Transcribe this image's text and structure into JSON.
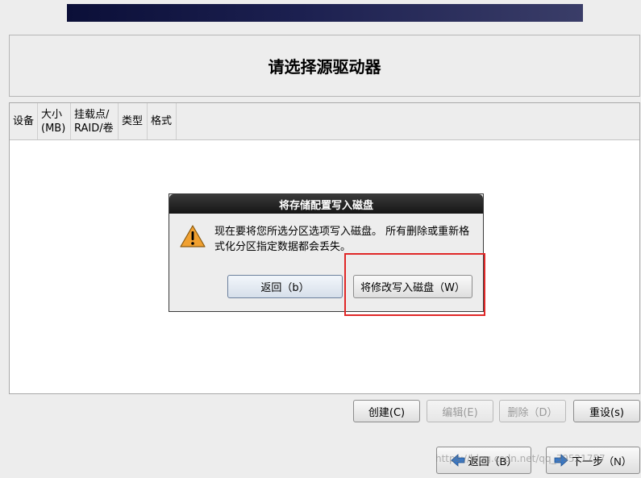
{
  "header": {
    "title": "请选择源驱动器"
  },
  "table": {
    "columns": [
      {
        "label": "设备"
      },
      {
        "label": "大小\n(MB)"
      },
      {
        "label": "挂载点/\nRAID/卷"
      },
      {
        "label": "类型"
      },
      {
        "label": "格式"
      }
    ]
  },
  "dialog": {
    "title": "将存储配置写入磁盘",
    "message": "现在要将您所选分区选项写入磁盘。 所有删除或重新格式化分区指定数据都会丢失。",
    "back_label": "返回（b）",
    "write_label": "将修改写入磁盘（W）"
  },
  "actions": {
    "create_label": "创建(C)",
    "edit_label": "编辑(E)",
    "delete_label": "删除（D）",
    "reset_label": "重设(s)"
  },
  "nav": {
    "back_label": "返回（B）",
    "next_label": "下一步（N）"
  },
  "watermark": "https://blog.csdn.net/qq_39521757"
}
